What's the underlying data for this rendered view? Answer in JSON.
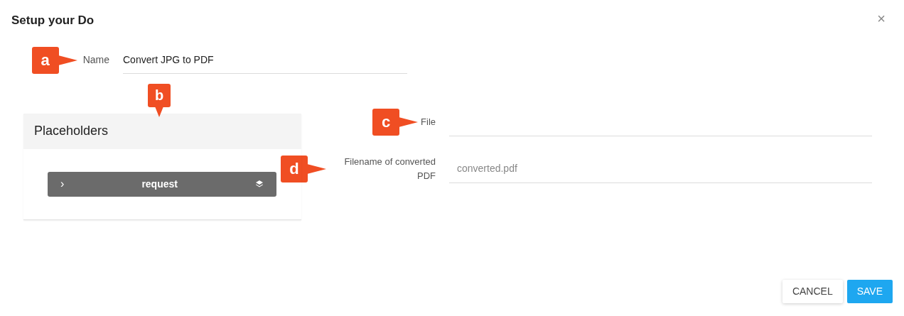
{
  "dialog": {
    "title": "Setup your Do",
    "close": "×"
  },
  "name_field": {
    "label": "Name",
    "value": "Convert JPG to PDF",
    "callout": "a"
  },
  "placeholders_panel": {
    "title": "Placeholders",
    "callout": "b",
    "items": [
      {
        "chevron": "›",
        "label": "request"
      }
    ]
  },
  "fields": [
    {
      "label": "File",
      "callout": "c"
    },
    {
      "label": "Filename of converted PDF",
      "placeholder": "converted.pdf",
      "callout": "d"
    }
  ],
  "buttons": [
    {
      "label": "CANCEL",
      "kind": "secondary"
    },
    {
      "label": "SAVE",
      "kind": "primary"
    }
  ]
}
